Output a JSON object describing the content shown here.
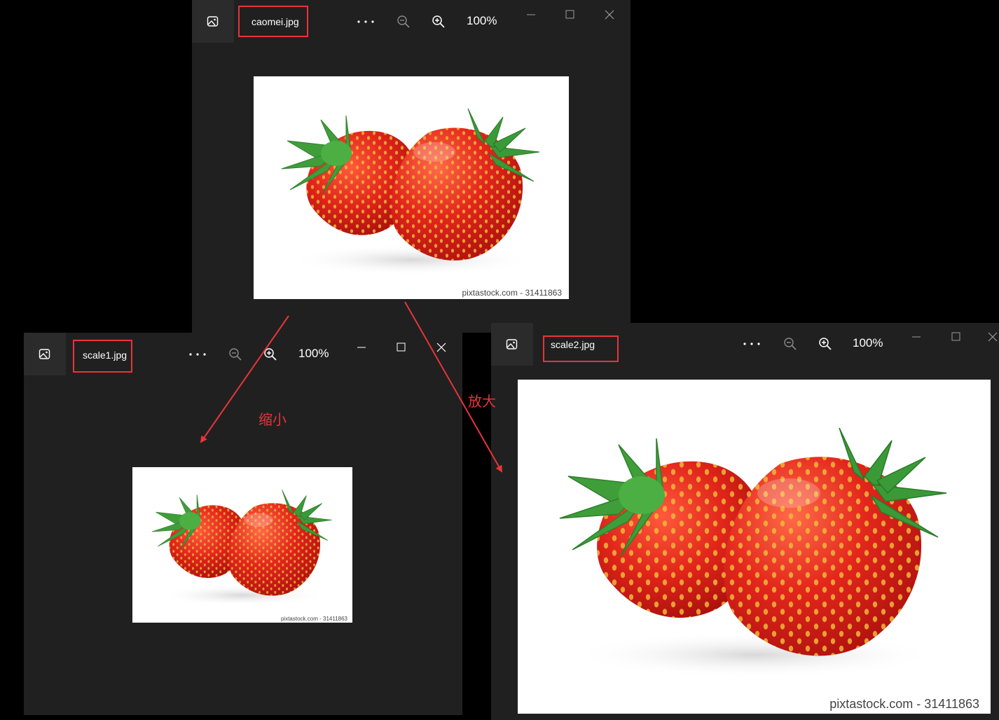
{
  "windows": [
    {
      "id": "top",
      "filename": "caomei.jpg",
      "zoom": "100%"
    },
    {
      "id": "left",
      "filename": "scale1.jpg",
      "zoom": "100%"
    },
    {
      "id": "right",
      "filename": "scale2.jpg",
      "zoom": "100%"
    }
  ],
  "photo": {
    "watermark": "pixtastock.com - 31411863"
  },
  "annotations": {
    "shrink_label": "缩小",
    "enlarge_label": "放大"
  },
  "icons": {
    "app": "image-viewer-icon",
    "more": "more-options-icon",
    "zoom_out": "zoom-out-icon",
    "zoom_in": "zoom-in-icon",
    "minimize": "minimize-icon",
    "maximize": "maximize-icon",
    "close": "close-icon"
  },
  "colors": {
    "annotation": "#e8343a",
    "window_bg": "#202020",
    "background": "#000000"
  }
}
